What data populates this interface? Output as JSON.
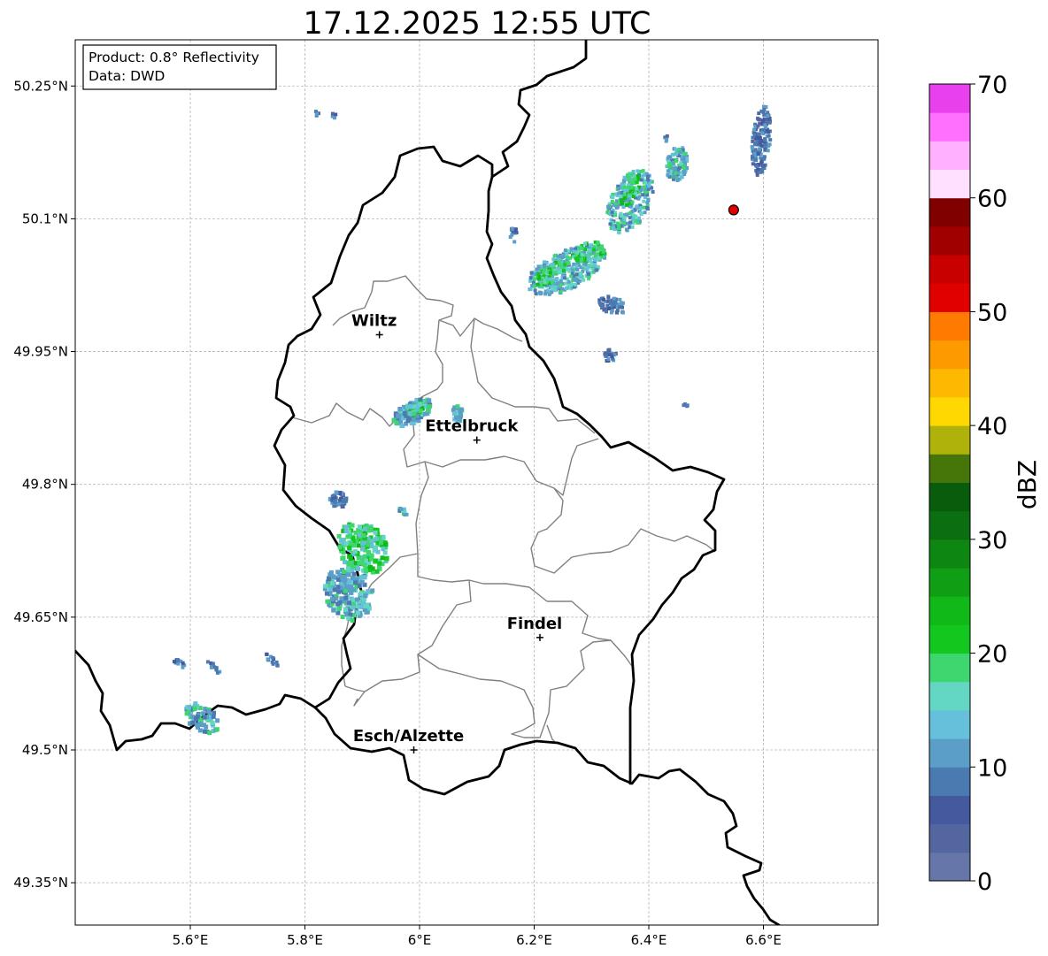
{
  "title": "17.12.2025 12:55 UTC",
  "info": {
    "product": "Product: 0.8° Reflectivity",
    "source": "Data: DWD"
  },
  "axes": {
    "lon_ticks": [
      "5.6°E",
      "5.8°E",
      "6°E",
      "6.2°E",
      "6.4°E",
      "6.6°E"
    ],
    "lat_ticks": [
      "50.25°N",
      "50.1°N",
      "49.95°N",
      "49.8°N",
      "49.65°N",
      "49.5°N",
      "49.35°N"
    ],
    "grid": true
  },
  "cities": [
    {
      "name": "Wiltz",
      "lon": 5.93,
      "lat": 49.969
    },
    {
      "name": "Ettelbruck",
      "lon": 6.1,
      "lat": 49.85
    },
    {
      "name": "Findel",
      "lon": 6.21,
      "lat": 49.627
    },
    {
      "name": "Esch/Alzette",
      "lon": 5.99,
      "lat": 49.5
    }
  ],
  "radar_marker": {
    "lon": 6.548,
    "lat": 50.11,
    "color": "#e00000"
  },
  "colorbar": {
    "label": "dBZ",
    "ticks": [
      "0",
      "10",
      "20",
      "30",
      "40",
      "50",
      "60",
      "70"
    ],
    "colors": [
      "#6676a8",
      "#5466a0",
      "#44599e",
      "#4a7ab0",
      "#5b9ec8",
      "#66c0dc",
      "#64d6c4",
      "#3ed66e",
      "#12c81e",
      "#10b818",
      "#0f9e14",
      "#0e8612",
      "#0b6e10",
      "#085c0c",
      "#46760a",
      "#aeb20a",
      "#fed800",
      "#fdb800",
      "#fd9a00",
      "#fe7a00",
      "#e00000",
      "#c80000",
      "#a00000",
      "#800000",
      "#ffe0ff",
      "#ffb0ff",
      "#ff70ff",
      "#e840ec"
    ]
  }
}
